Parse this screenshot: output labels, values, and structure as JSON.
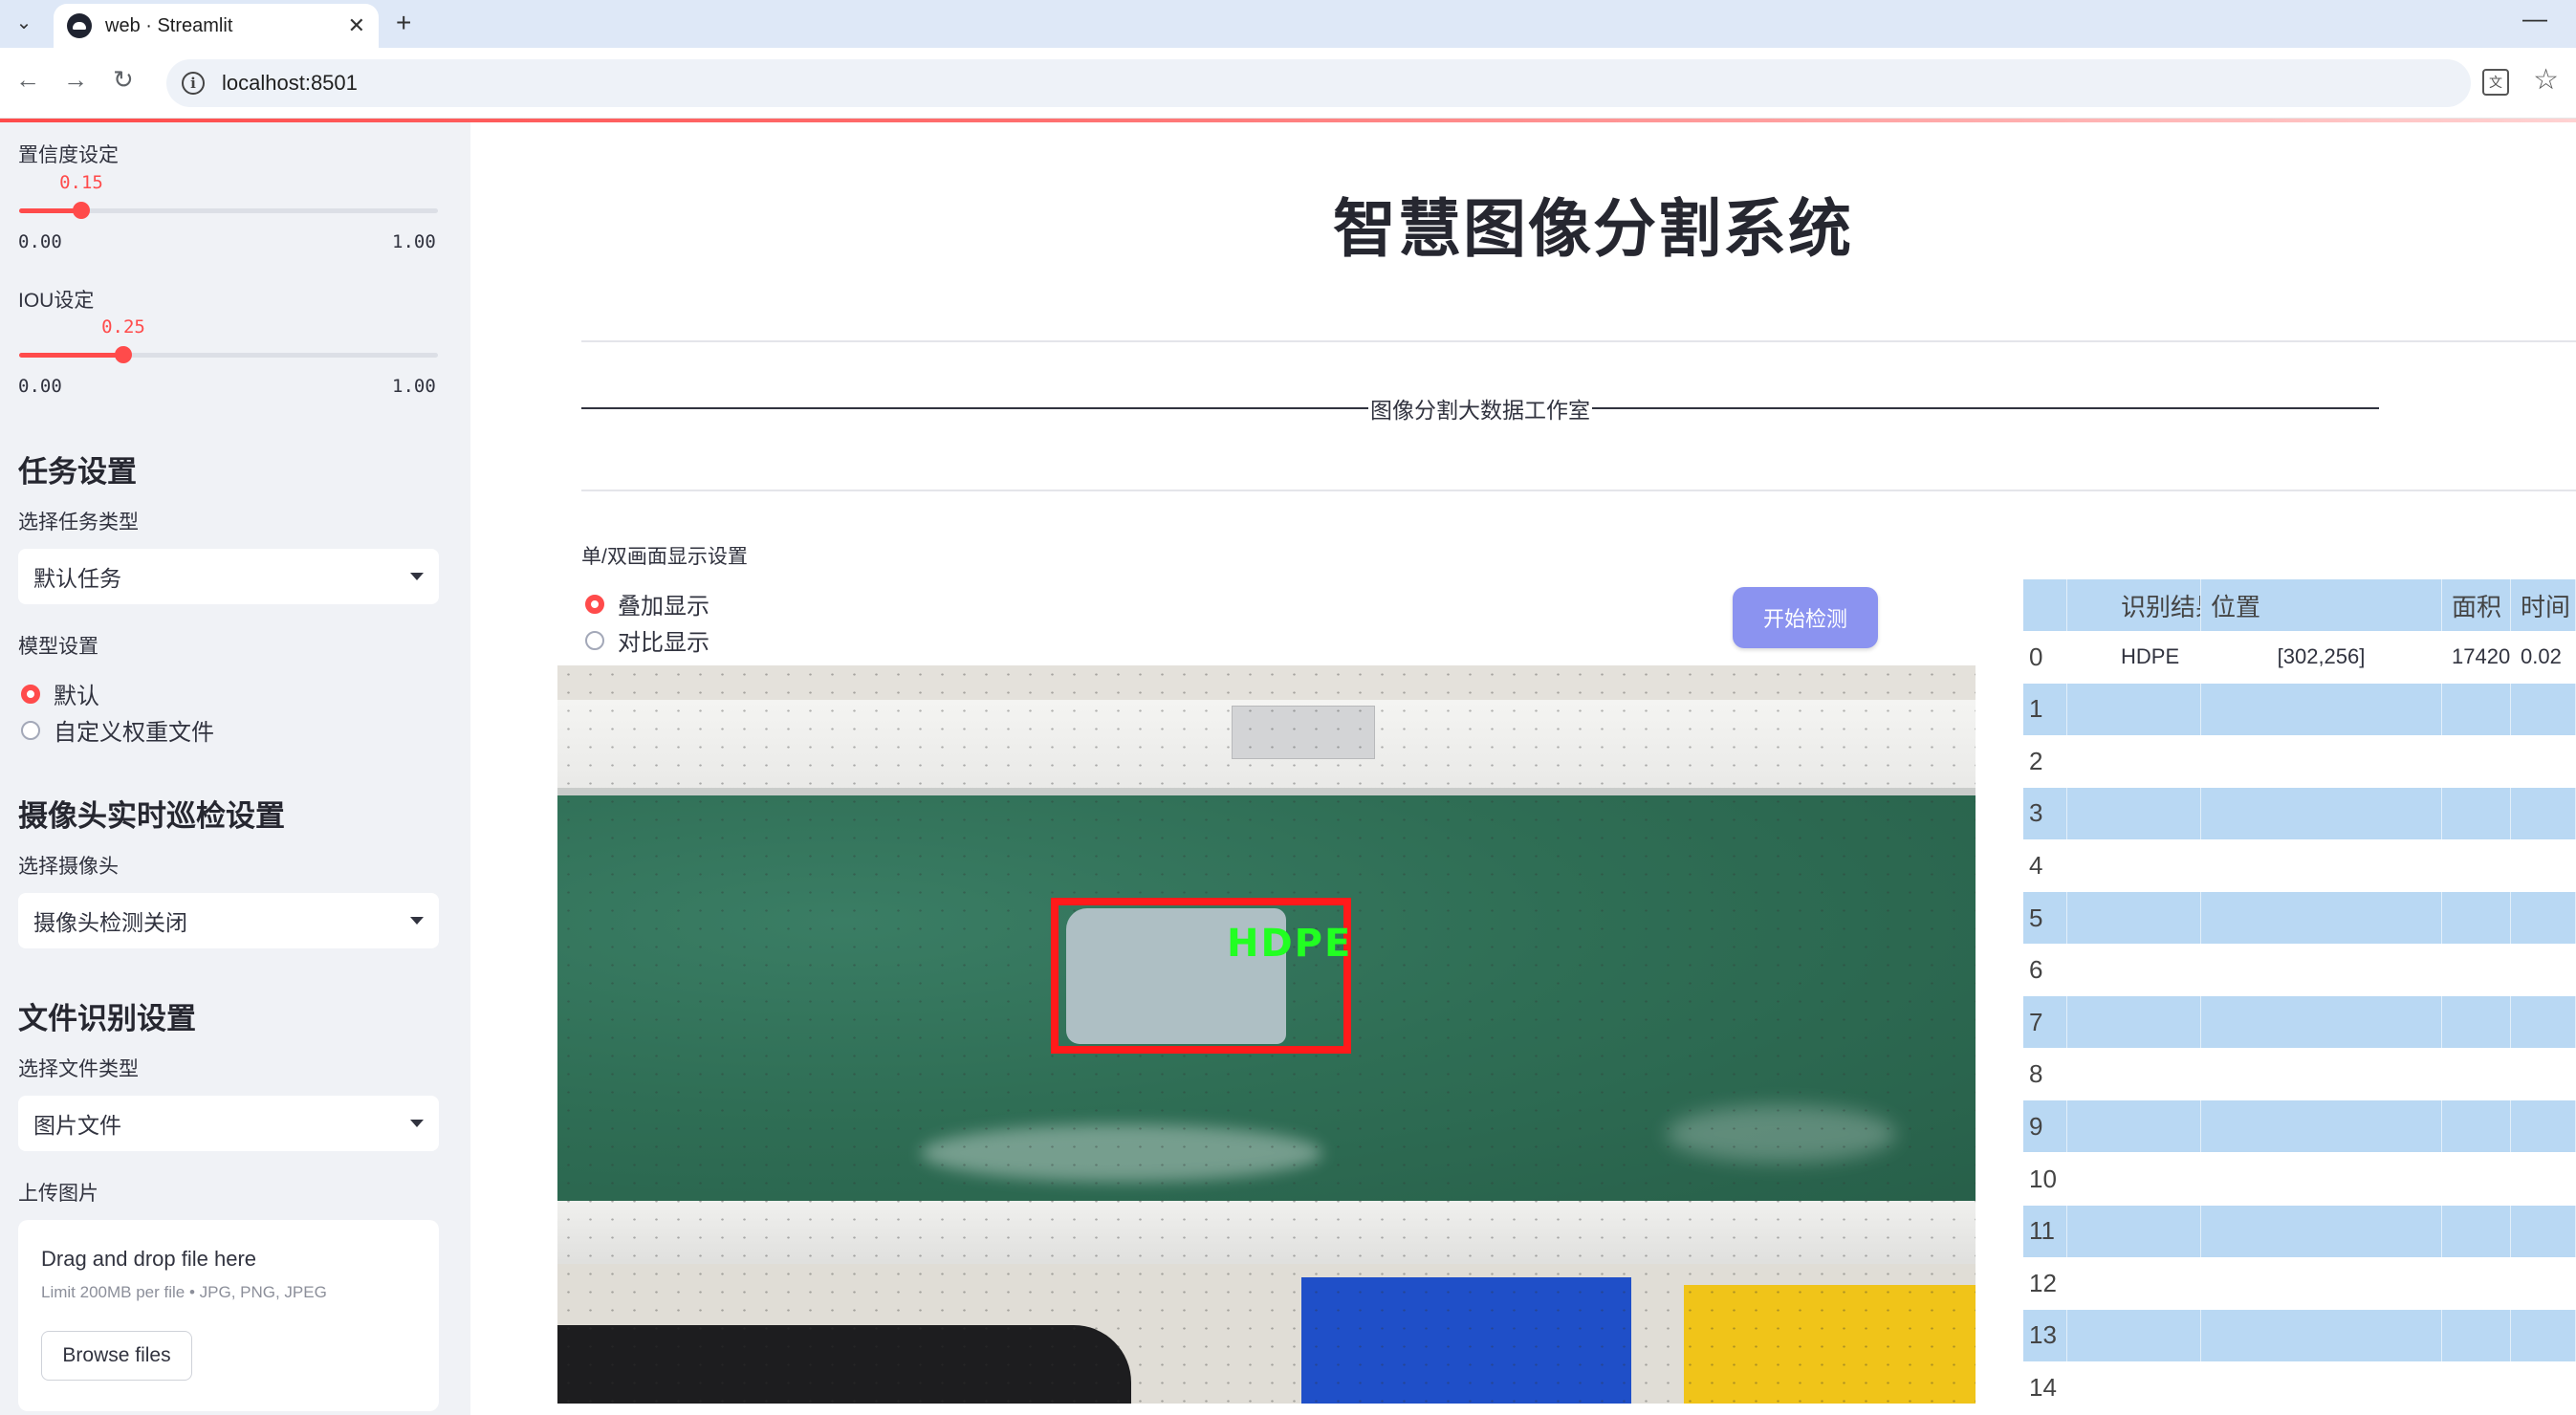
{
  "browser": {
    "tab_title": "web · Streamlit",
    "url": "localhost:8501"
  },
  "sidebar": {
    "confidence": {
      "label": "置信度设定",
      "value": "0.15",
      "value_fraction": 0.15,
      "min": "0.00",
      "max": "1.00"
    },
    "iou": {
      "label": "IOU设定",
      "value": "0.25",
      "value_fraction": 0.25,
      "min": "0.00",
      "max": "1.00"
    },
    "task_header": "任务设置",
    "task_type_label": "选择任务类型",
    "task_type_value": "默认任务",
    "model_label": "模型设置",
    "model_options": [
      "默认",
      "自定义权重文件"
    ],
    "model_selected": 0,
    "camera_header": "摄像头实时巡检设置",
    "camera_label": "选择摄像头",
    "camera_value": "摄像头检测关闭",
    "file_header": "文件识别设置",
    "file_type_label": "选择文件类型",
    "file_type_value": "图片文件",
    "upload_label": "上传图片",
    "upload_title": "Drag and drop file here",
    "upload_limit": "Limit 200MB per file • JPG, PNG, JPEG",
    "browse_label": "Browse files"
  },
  "main": {
    "title": "智慧图像分割系统",
    "subtitle": "图像分割大数据工作室",
    "display_label": "单/双画面显示设置",
    "display_options": [
      "叠加显示",
      "对比显示"
    ],
    "display_selected": 0,
    "start_button": "开始检测",
    "detection_label": "HDPE"
  },
  "table": {
    "columns": [
      "识别结果",
      "位置",
      "面积",
      "时间"
    ],
    "rows": [
      {
        "index": "0",
        "result": "HDPE",
        "position": "[302,256]",
        "area": "17420",
        "time": "0.02"
      },
      {
        "index": "1"
      },
      {
        "index": "2"
      },
      {
        "index": "3"
      },
      {
        "index": "4"
      },
      {
        "index": "5"
      },
      {
        "index": "6"
      },
      {
        "index": "7"
      },
      {
        "index": "8"
      },
      {
        "index": "9"
      },
      {
        "index": "10"
      },
      {
        "index": "11"
      },
      {
        "index": "12"
      },
      {
        "index": "13"
      },
      {
        "index": "14"
      }
    ]
  },
  "colors": {
    "accent": "#ff4b4b",
    "button": "#8b93f0",
    "table_stripe": "#b9d8f3",
    "belt": "#2f6e55",
    "detect_box": "#ff1a1a",
    "detect_text": "#22ff22"
  }
}
